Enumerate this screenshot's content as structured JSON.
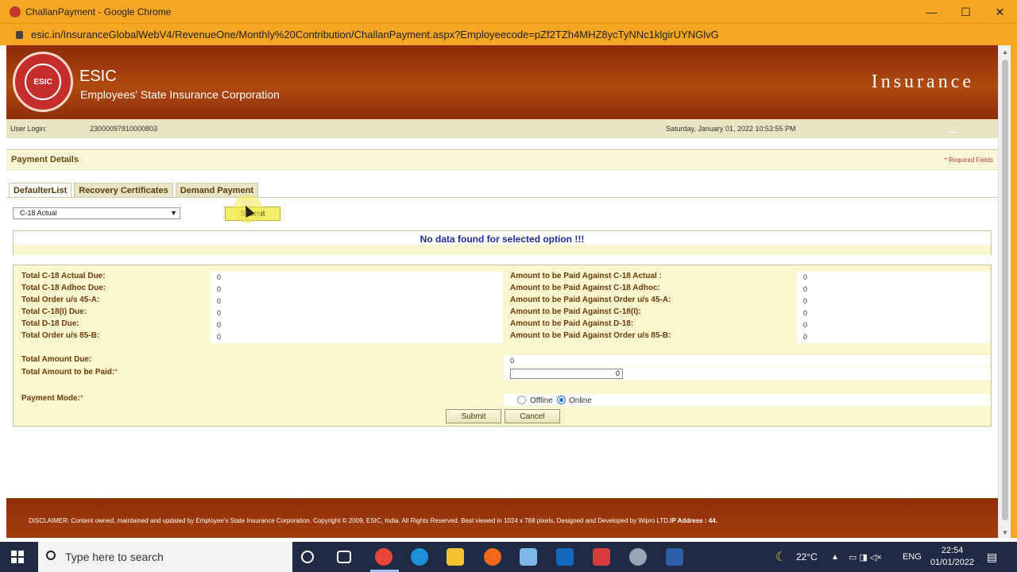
{
  "browser": {
    "window_title": "ChallanPayment - Google Chrome",
    "url": "esic.in/InsuranceGlobalWebV4/RevenueOne/Monthly%20Contribution/ChallanPayment.aspx?Employeecode=pZf2TZh4MHZ8ycTyNNc1klgirUYNGlvG",
    "controls": {
      "minimize": "—",
      "maximize": "☐",
      "close": "✕"
    }
  },
  "header": {
    "logo_text": "ESIC",
    "org_short": "ESIC",
    "org_long": "Employees' State Insurance Corporation",
    "brand": "Insurance"
  },
  "login_bar": {
    "label": "User Login:",
    "user_id": "23000097810000803",
    "datetime": "Saturday, January 01, 2022 10:53:55 PM"
  },
  "section": {
    "title": "Payment Details",
    "required_note": "* Required Fields"
  },
  "tabs": [
    {
      "label": "DefaulterList",
      "active": true
    },
    {
      "label": "Recovery Certificates",
      "active": false
    },
    {
      "label": "Demand Payment",
      "active": false
    }
  ],
  "filter": {
    "selected_option": "C-18 Actual",
    "submit_label": "Submit"
  },
  "message": "No data found for selected option !!!",
  "dues": [
    {
      "label": "Total C-18 Actual Due:",
      "value": "0",
      "pay_label": "Amount to be Paid Against C-18 Actual :",
      "pay_value": "0"
    },
    {
      "label": "Total C-18 Adhoc Due:",
      "value": "0",
      "pay_label": "Amount to be Paid Against C-18 Adhoc:",
      "pay_value": "0"
    },
    {
      "label": "Total Order u/s 45-A:",
      "value": "0",
      "pay_label": "Amount to be Paid Against Order u/s 45-A:",
      "pay_value": "0"
    },
    {
      "label": "Total C-18(I) Due:",
      "value": "0",
      "pay_label": "Amount to be Paid Against C-18(I):",
      "pay_value": "0"
    },
    {
      "label": "Total D-18 Due:",
      "value": "0",
      "pay_label": "Amount to be Paid Against D-18:",
      "pay_value": "0"
    },
    {
      "label": "Total Order u/s 85-B:",
      "value": "0",
      "pay_label": "Amount to be Paid Against Order u/s 85-B:",
      "pay_value": "0"
    }
  ],
  "totals": {
    "amount_due_label": "Total Amount Due:",
    "amount_due_value": "0",
    "amount_to_pay_label": "Total Amount to be Paid:",
    "required_mark": "*",
    "amount_to_pay_value": "0"
  },
  "payment_mode": {
    "label": "Payment Mode:",
    "required_mark": "*",
    "options": [
      "Offline",
      "Online"
    ],
    "selected": "Online"
  },
  "actions": {
    "submit": "Submit",
    "cancel": "Cancel"
  },
  "footer": {
    "disclaimer": "DISCLAIMER: Content owned, maintained and updated by Employee's State Insurance Corporation. Copyright © 2009, ESIC, India. All Rights Reserved. Best viewed in 1024 x 768 pixels, Designed and Developed by Wipro LTD.",
    "ip_label": "IP Address : 44."
  },
  "taskbar": {
    "search_placeholder": "Type here to search",
    "temperature": "22°C",
    "language": "ENG",
    "time": "22:54",
    "date": "01/01/2022"
  },
  "colors": {
    "title_bar": "#f5a623",
    "header_brown": "#a33f0c",
    "label_brown": "#6b3a0a",
    "message_blue": "#1f2b8f",
    "panel_cream": "#faf7d0"
  }
}
